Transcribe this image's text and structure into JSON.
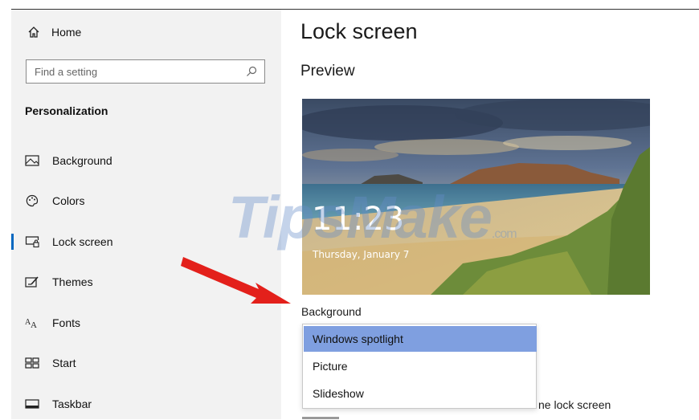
{
  "sidebar": {
    "home_label": "Home",
    "search_placeholder": "Find a setting",
    "section_title": "Personalization",
    "items": [
      {
        "label": "Background",
        "icon": "picture-icon"
      },
      {
        "label": "Colors",
        "icon": "palette-icon"
      },
      {
        "label": "Lock screen",
        "icon": "lock-screen-icon",
        "active": true
      },
      {
        "label": "Themes",
        "icon": "themes-icon"
      },
      {
        "label": "Fonts",
        "icon": "fonts-icon"
      },
      {
        "label": "Start",
        "icon": "start-icon"
      },
      {
        "label": "Taskbar",
        "icon": "taskbar-icon"
      }
    ]
  },
  "main": {
    "title": "Lock screen",
    "preview_label": "Preview",
    "preview": {
      "time": "11:23",
      "date": "Thursday, January 7"
    },
    "background_label": "Background",
    "dropdown_options": [
      "Windows spotlight",
      "Picture",
      "Slideshow"
    ],
    "selected_option": "Windows spotlight",
    "partial_text": "ne lock screen"
  },
  "watermark": {
    "text": "TipsMake",
    "suffix": ".com"
  },
  "colors": {
    "accent": "#0067c0",
    "selection": "#7f9fe0",
    "arrow": "#e3201b"
  }
}
